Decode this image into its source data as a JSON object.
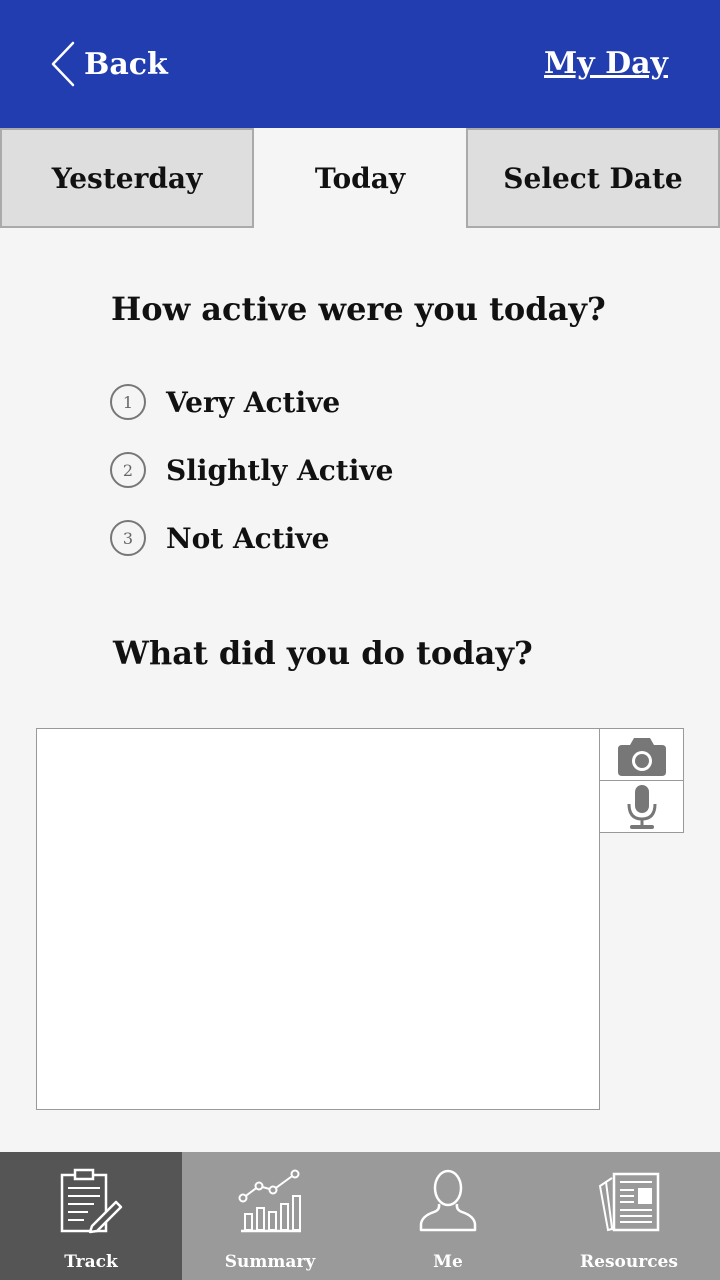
{
  "header": {
    "back_label": "Back",
    "title_link": "My Day",
    "background": "#223daf"
  },
  "tabs": [
    {
      "label": "Yesterday",
      "active": false
    },
    {
      "label": "Today",
      "active": true
    },
    {
      "label": "Select Date",
      "active": false
    }
  ],
  "activity": {
    "question": "How active were you today?",
    "options": [
      {
        "number": "1",
        "label": "Very Active"
      },
      {
        "number": "2",
        "label": "Slightly Active"
      },
      {
        "number": "3",
        "label": "Not Active"
      }
    ]
  },
  "journal": {
    "question": "What did you do today?",
    "value": "",
    "attachments": [
      "camera-icon",
      "microphone-icon"
    ]
  },
  "bottom_nav": {
    "items": [
      {
        "label": "Track",
        "icon": "clipboard-icon",
        "selected": true
      },
      {
        "label": "Summary",
        "icon": "chart-icon",
        "selected": false
      },
      {
        "label": "Me",
        "icon": "person-icon",
        "selected": false
      },
      {
        "label": "Resources",
        "icon": "newspaper-icon",
        "selected": false
      }
    ],
    "selected_color": "#555555",
    "background": "#9a9a9a"
  }
}
